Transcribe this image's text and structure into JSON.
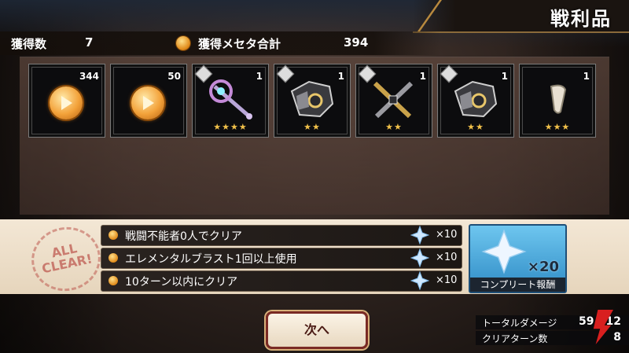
{
  "title": "戦利品",
  "stats": {
    "count_label": "獲得数",
    "count_value": "7",
    "meseta_label": "獲得メセタ合計",
    "meseta_value": "394"
  },
  "items": [
    {
      "kind": "meseta-coin",
      "qty": "344",
      "stars": ""
    },
    {
      "kind": "meseta-coin",
      "qty": "50",
      "stars": ""
    },
    {
      "kind": "staff-weapon",
      "qty": "1",
      "stars": "★★★★"
    },
    {
      "kind": "armor-gear",
      "qty": "1",
      "stars": "★★"
    },
    {
      "kind": "crossed-weapons",
      "qty": "1",
      "stars": "★★"
    },
    {
      "kind": "armor-gear",
      "qty": "1",
      "stars": "★★"
    },
    {
      "kind": "fang-material",
      "qty": "1",
      "stars": "★★★"
    }
  ],
  "seal": {
    "line1": "ALL",
    "line2": "CLEAR!"
  },
  "missions": [
    {
      "label": "戦闘不能者0人でクリア",
      "reward": "×10"
    },
    {
      "label": "エレメンタルブラスト1回以上使用",
      "reward": "×10"
    },
    {
      "label": "10ターン以内にクリア",
      "reward": "×10"
    }
  ],
  "complete_reward": {
    "multiplier": "×20",
    "label": "コンプリート報酬"
  },
  "next_button": "次へ",
  "battle_stats": {
    "damage_label": "トータルダメージ",
    "damage_value": "59,312",
    "turns_label": "クリアターン数",
    "turns_value": "8"
  },
  "colors": {
    "star": "#f1c14a",
    "button_border": "#7a2a24",
    "complete_bg": "#4aa8dc"
  }
}
